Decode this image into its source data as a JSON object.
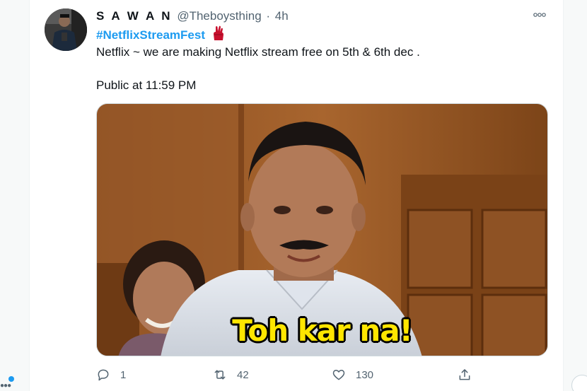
{
  "tweet": {
    "display_name": "S A W A N",
    "handle": "@Theboysthing",
    "separator": "·",
    "time": "4h",
    "hashtag": "#NetflixStreamFest",
    "text": "Netflix ~ we are making Netflix stream free on 5th & 6th dec .",
    "public_line": "Public at 11:59 PM",
    "media": {
      "caption": "Toh kar na!"
    },
    "actions": {
      "reply_count": "1",
      "retweet_count": "42",
      "like_count": "130"
    },
    "icons": {
      "more": "more-horizontal-icon",
      "emoji": "victory-hand-emoji-icon",
      "reply": "reply-icon",
      "retweet": "retweet-icon",
      "like": "heart-icon",
      "share": "share-icon"
    }
  },
  "colors": {
    "accent": "#1d9bf0",
    "muted": "#536471",
    "text": "#0f1419",
    "caption": "#ffe600"
  }
}
